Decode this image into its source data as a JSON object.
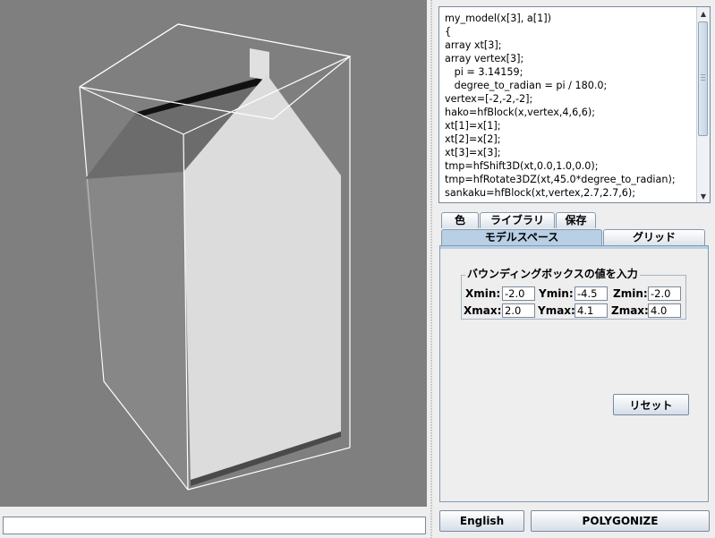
{
  "code_editor": {
    "lines": [
      "my_model(x[3], a[1])",
      "{",
      "array xt[3];",
      "array vertex[3];",
      "   pi = 3.14159;",
      "   degree_to_radian = pi / 180.0;",
      "vertex=[-2,-2,-2];",
      "hako=hfBlock(x,vertex,4,6,6);",
      "xt[1]=x[1];",
      "xt[2]=x[2];",
      "xt[3]=x[3];",
      "tmp=hfShift3D(xt,0.0,1.0,0.0);",
      "tmp=hfRotate3DZ(xt,45.0*degree_to_radian);",
      "sankaku=hfBlock(xt,vertex,2.7,2.7,6);"
    ]
  },
  "tabs_top": {
    "color": "色",
    "library": "ライブラリ",
    "save": "保存"
  },
  "tabs_second": {
    "model_space": "モデルスペース",
    "grid": "グリッド"
  },
  "bounding_box": {
    "title": "バウンディングボックスの値を入力",
    "xmin_label": "Xmin:",
    "xmin": "-2.0",
    "ymin_label": "Ymin:",
    "ymin": "-4.5",
    "zmin_label": "Zmin:",
    "zmin": "-2.0",
    "xmax_label": "Xmax:",
    "xmax": "2.0",
    "ymax_label": "Ymax:",
    "ymax": "4.1",
    "zmax_label": "Zmax:",
    "zmax": "4.0"
  },
  "buttons": {
    "reset": "リセット",
    "english": "English",
    "polygonize": "POLYGONIZE"
  },
  "command_input": {
    "value": ""
  },
  "colors": {
    "viewport_bg": "#7f7f7f",
    "active_tab": "#b8cfe5",
    "panel_bg": "#eeeeee"
  }
}
